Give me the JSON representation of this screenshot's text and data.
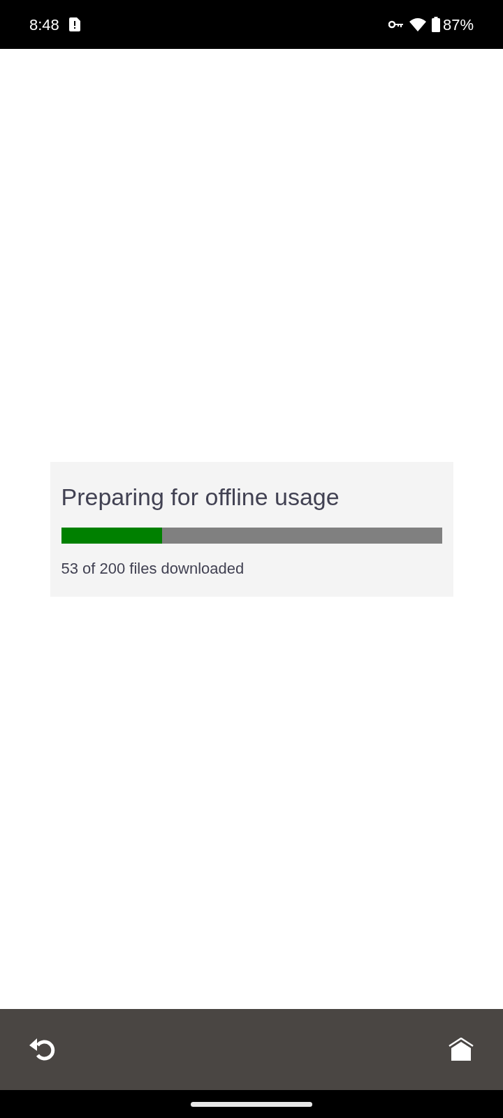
{
  "status_bar": {
    "time": "8:48",
    "battery": "87%"
  },
  "progress_card": {
    "title": "Preparing for offline usage",
    "level": 0.265,
    "caption": "53 of 200 files downloaded"
  }
}
